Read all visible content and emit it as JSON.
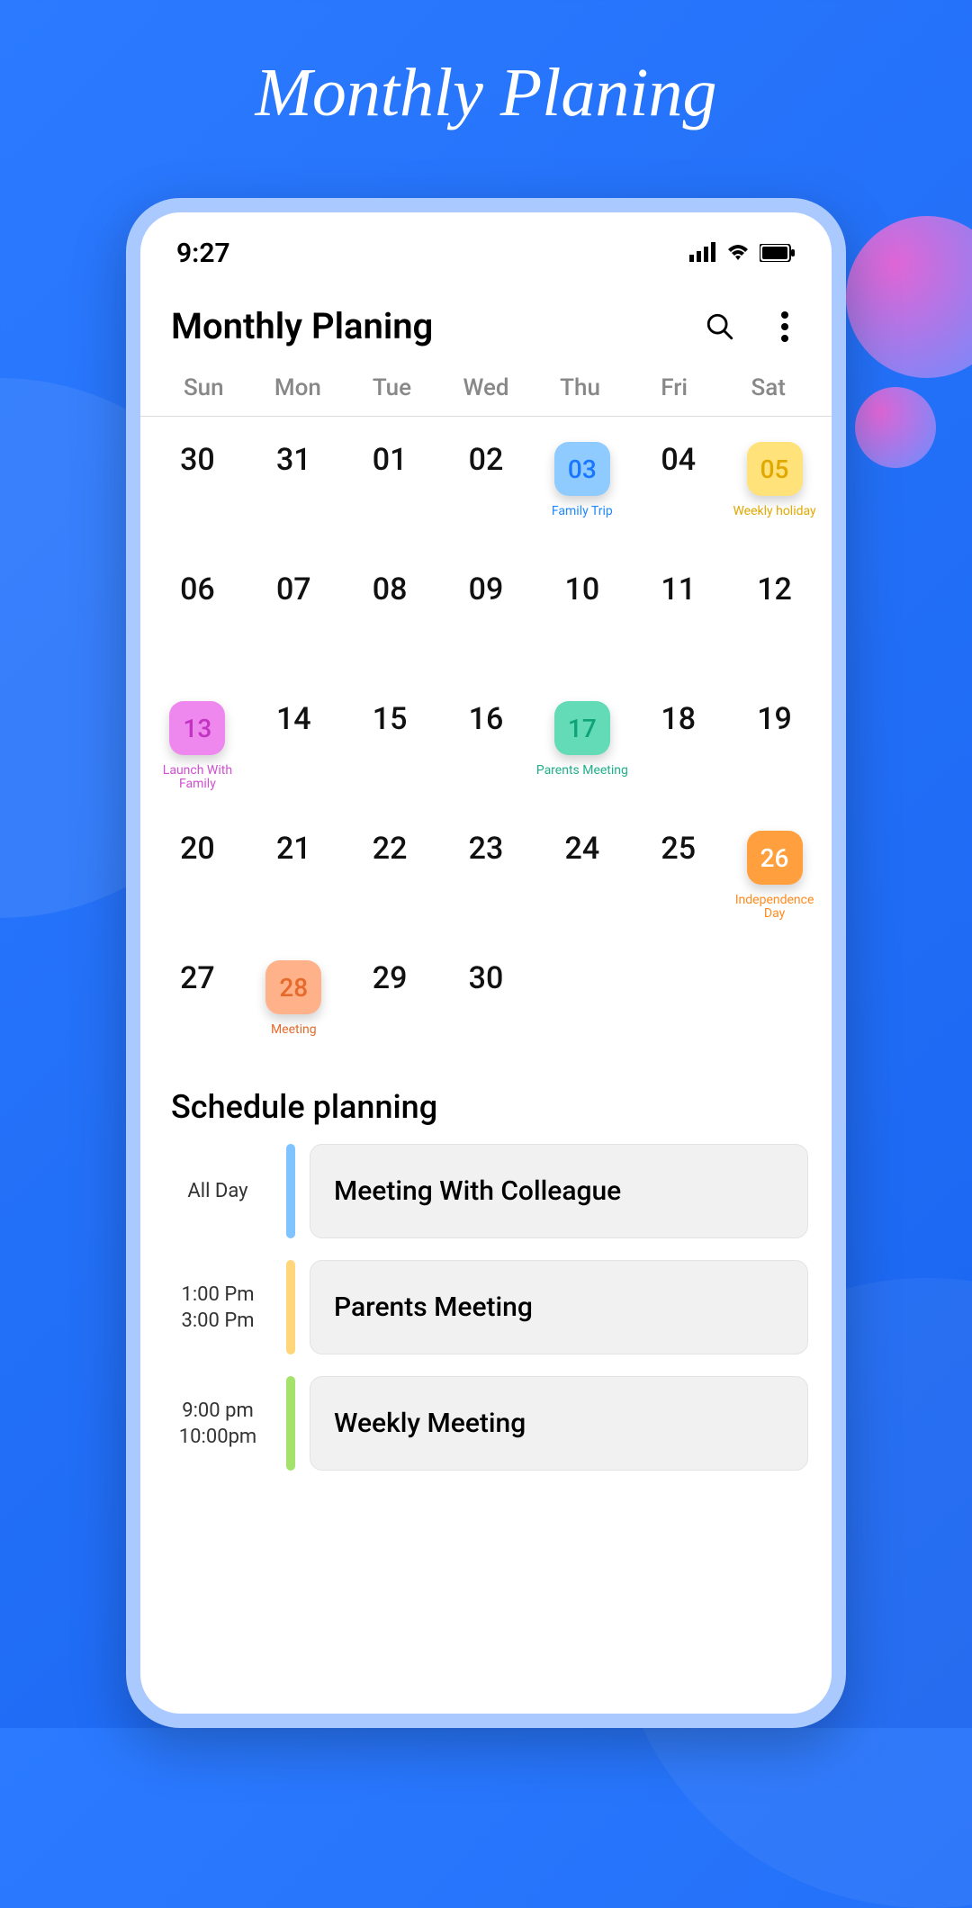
{
  "promo": {
    "title": "Monthly Planing"
  },
  "status": {
    "time": "9:27"
  },
  "header": {
    "title": "Monthly Planing"
  },
  "weekdays": [
    "Sun",
    "Mon",
    "Tue",
    "Wed",
    "Thu",
    "Fri",
    "Sat"
  ],
  "calendar": [
    {
      "num": "30"
    },
    {
      "num": "31"
    },
    {
      "num": "01"
    },
    {
      "num": "02"
    },
    {
      "num": "03",
      "badge": true,
      "bg": "#8fcbff",
      "fg": "#1976ff",
      "label": "Family Trip",
      "labelColor": "#1e88ff"
    },
    {
      "num": "04"
    },
    {
      "num": "05",
      "badge": true,
      "bg": "#ffe27a",
      "fg": "#e0a800",
      "label": "Weekly holiday",
      "labelColor": "#e0a800"
    },
    {
      "num": "06"
    },
    {
      "num": "07"
    },
    {
      "num": "08"
    },
    {
      "num": "09"
    },
    {
      "num": "10"
    },
    {
      "num": "11"
    },
    {
      "num": "12"
    },
    {
      "num": "13",
      "badge": true,
      "bg": "#ee88ee",
      "fg": "#c233c2",
      "label": "Launch With Family",
      "labelColor": "#d14fd1"
    },
    {
      "num": "14"
    },
    {
      "num": "15"
    },
    {
      "num": "16"
    },
    {
      "num": "17",
      "badge": true,
      "bg": "#63dbb6",
      "fg": "#0fa37a",
      "label": "Parents Meeting",
      "labelColor": "#1fb08a"
    },
    {
      "num": "18"
    },
    {
      "num": "19"
    },
    {
      "num": "20"
    },
    {
      "num": "21"
    },
    {
      "num": "22"
    },
    {
      "num": "23"
    },
    {
      "num": "24"
    },
    {
      "num": "25"
    },
    {
      "num": "26",
      "badge": true,
      "bg": "#ff9f3d",
      "fg": "#ffffff",
      "label": "Independence Day",
      "labelColor": "#ff8a1f"
    },
    {
      "num": "27"
    },
    {
      "num": "28",
      "badge": true,
      "bg": "#ffb28a",
      "fg": "#e56a2b",
      "label": "Meeting",
      "labelColor": "#e56a2b"
    },
    {
      "num": "29"
    },
    {
      "num": "30"
    }
  ],
  "schedule": {
    "title": "Schedule planning",
    "items": [
      {
        "time1": "All Day",
        "time2": "",
        "color": "#7fc4ff",
        "title": "Meeting With Colleague"
      },
      {
        "time1": "1:00 Pm",
        "time2": "3:00 Pm",
        "color": "#ffd77a",
        "title": "Parents Meeting"
      },
      {
        "time1": "9:00 pm",
        "time2": "10:00pm",
        "color": "#a4e26b",
        "title": "Weekly Meeting"
      }
    ]
  }
}
